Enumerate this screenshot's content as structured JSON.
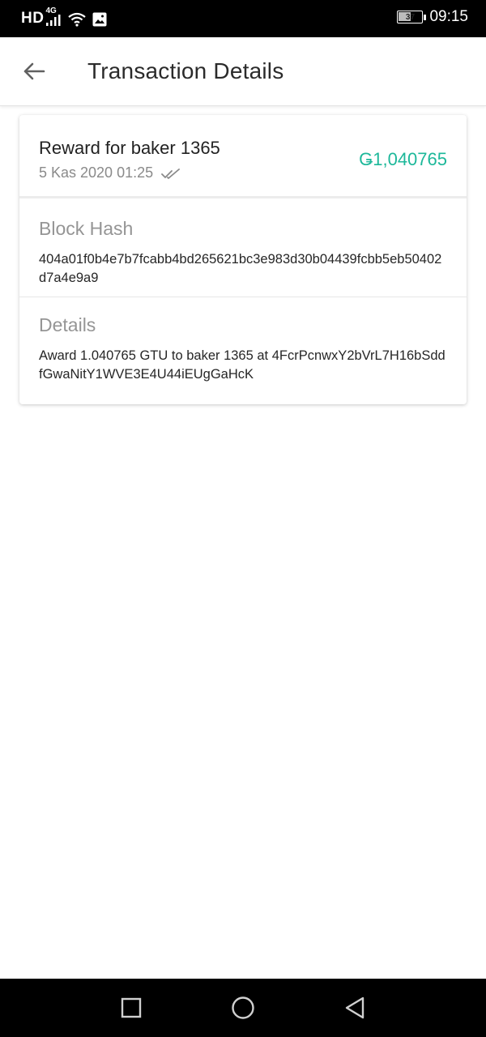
{
  "status_bar": {
    "network_hd": "HD",
    "network_type": "4G",
    "battery": "37",
    "time": "09:15"
  },
  "app_bar": {
    "title": "Transaction Details",
    "back_icon": "arrow-back-icon"
  },
  "transaction": {
    "title": "Reward for baker 1365",
    "date": "5 Kas 2020 01:25",
    "status_icon": "double-check-icon",
    "amount": "Ǥ1,040765",
    "amount_color": "#1db89a"
  },
  "block_hash": {
    "label": "Block Hash",
    "value": "404a01f0b4e7b7fcabb4bd265621bc3e983d30b04439fcbb5eb50402d7a4e9a9"
  },
  "details": {
    "label": "Details",
    "value": "Award 1.040765 GTU to baker 1365 at 4FcrPcnwxY2bVrL7H16bSddfGwaNitY1WVE3E4U44iEUgGaHcK"
  },
  "nav_bar": {
    "recents_icon": "square-icon",
    "home_icon": "circle-icon",
    "back_icon": "triangle-back-icon"
  }
}
